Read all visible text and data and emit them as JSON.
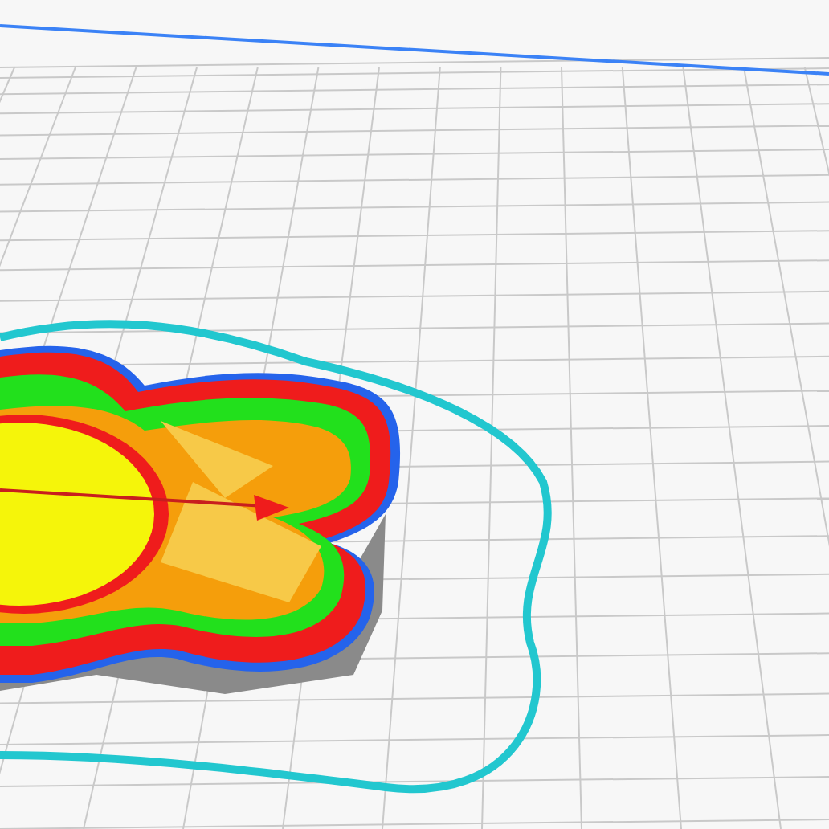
{
  "layer_view": {
    "skirt_shown": true
  }
}
